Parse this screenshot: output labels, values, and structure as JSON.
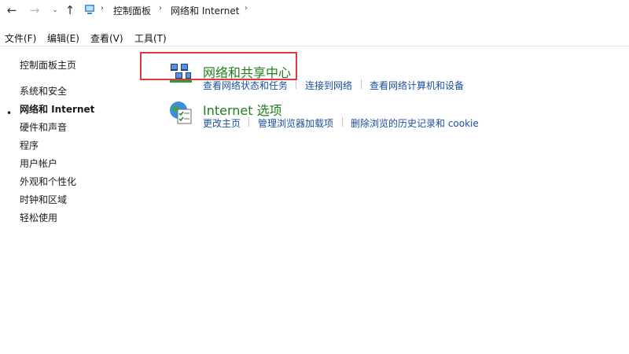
{
  "breadcrumb": {
    "items": [
      "控制面板",
      "网络和 Internet"
    ]
  },
  "menubar": {
    "items": [
      "文件(F)",
      "编辑(E)",
      "查看(V)",
      "工具(T)"
    ]
  },
  "sidebar": {
    "home": "控制面板主页",
    "items": [
      "系统和安全",
      "网络和 Internet",
      "硬件和声音",
      "程序",
      "用户帐户",
      "外观和个性化",
      "时钟和区域",
      "轻松使用"
    ],
    "active_index": 1
  },
  "categories": [
    {
      "title": "网络和共享中心",
      "icon": "network-sharing-icon",
      "links": [
        "查看网络状态和任务",
        "连接到网络",
        "查看网络计算机和设备"
      ]
    },
    {
      "title": "Internet 选项",
      "icon": "internet-options-icon",
      "links": [
        "更改主页",
        "管理浏览器加载项",
        "删除浏览的历史记录和 cookie"
      ]
    }
  ],
  "colors": {
    "category_title": "#1e7c1e",
    "link": "#1a4fa0",
    "highlight_box": "#e03a3a"
  }
}
